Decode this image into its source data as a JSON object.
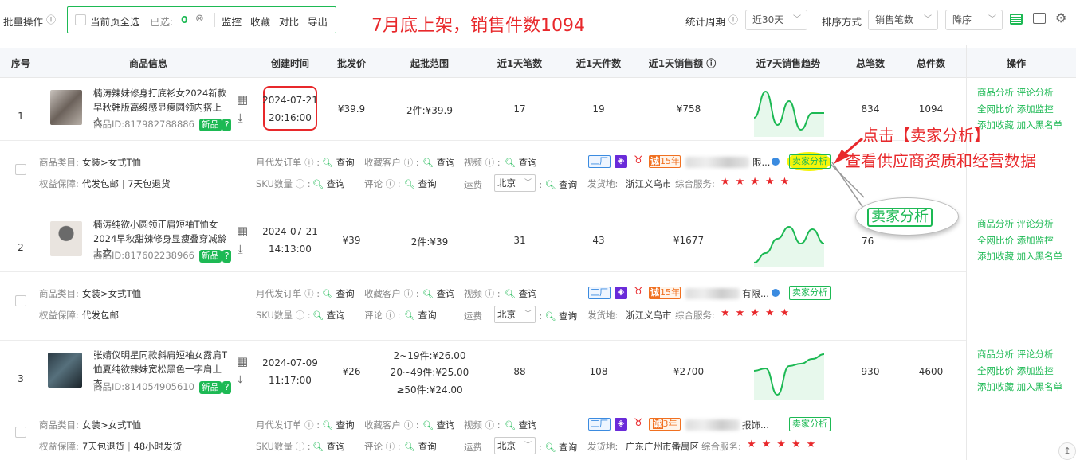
{
  "toolbar": {
    "batch_label": "批量操作",
    "select_all_label": "当前页全选",
    "selected_label": "已选:",
    "selected_count": "0",
    "actions": [
      "监控",
      "收藏",
      "对比",
      "导出"
    ],
    "period_label": "统计周期",
    "period_value": "近30天",
    "sort_label": "排序方式",
    "sort_value": "销售笔数",
    "order_value": "降序"
  },
  "annotations": {
    "top_note": "7月底上架，销售件数1094",
    "right_note_line1": "点击【卖家分析】",
    "right_note_line2": "查看供应商资质和经营数据",
    "zoom_label": "卖家分析"
  },
  "columns": [
    "序号",
    "商品信息",
    "创建时间",
    "批发价",
    "起批范围",
    "近1天笔数",
    "近1天件数",
    "近1天销售额",
    "近7天销售趋势",
    "总笔数",
    "总件数",
    "操作"
  ],
  "labels": {
    "product_id_prefix": "商品ID:",
    "new_badge": "新品",
    "category_label": "商品类目:",
    "guarantee_label": "权益保障:",
    "monthly_orders_label": "月代发订单",
    "sku_label": "SKU数量",
    "fav_customers_label": "收藏客户",
    "review_label": "评论",
    "video_label": "视频",
    "shipping_label": "运费",
    "query": "查询",
    "ship_from_label": "发货地:",
    "service_label": "综合服务:",
    "factory_tag": "工厂",
    "seller_analysis": "卖家分析"
  },
  "rows": [
    {
      "index": "1",
      "name": "楠涛辣妹修身打底衫女2024新款早秋韩版高级感显瘦圆领内搭上衣",
      "product_id": "817982788886",
      "created_date": "2024-07-21",
      "created_time": "20:16:00",
      "price": "¥39.9",
      "range_lines": [
        "2件:¥39.9"
      ],
      "day_orders": "17",
      "day_pieces": "19",
      "day_sales": "¥758",
      "total_orders": "834",
      "total_pieces": "1094",
      "trend": [
        0.35,
        0.9,
        0.2,
        0.7,
        0.1,
        0.45,
        0.45
      ],
      "category": "女装>女式T恤",
      "guarantees": [
        "代发包邮",
        "7天包退货"
      ],
      "ship_city": "北京",
      "ship_from": "浙江义乌市",
      "years": "15年",
      "seller_tail": "限...",
      "stars": "★★★★★",
      "ops": [
        "商品分析",
        "评论分析",
        "全网比价",
        "添加监控",
        "添加收藏",
        "加入黑名单"
      ]
    },
    {
      "index": "2",
      "name": "楠涛纯欲小圆领正肩短袖T恤女2024早秋甜辣修身显瘦叠穿减龄上衣",
      "product_id": "817602238966",
      "created_date": "2024-07-21",
      "created_time": "14:13:00",
      "price": "¥39",
      "range_lines": [
        "2件:¥39"
      ],
      "day_orders": "31",
      "day_pieces": "43",
      "day_sales": "¥1677",
      "total_orders": "",
      "total_pieces": "",
      "trend": [
        0.05,
        0.25,
        0.55,
        0.8,
        0.45,
        0.75,
        0.45
      ],
      "category": "女装>女式T恤",
      "guarantees": [
        "代发包邮"
      ],
      "ship_city": "北京",
      "ship_from": "浙江义乌市",
      "years": "15年",
      "seller_tail": "有限...",
      "stars": "★★★★★",
      "ops": [
        "商品分析",
        "评论分析",
        "全网比价",
        "添加监控",
        "添加收藏",
        "加入黑名单"
      ]
    },
    {
      "index": "3",
      "name": "张婧仪明星同款斜肩短袖女露肩T恤夏纯欲辣妹宽松黑色一字肩上衣",
      "product_id": "814054905610",
      "created_date": "2024-07-09",
      "created_time": "11:17:00",
      "price": "¥26",
      "range_lines": [
        "2~19件:¥26.00",
        "20~49件:¥25.00",
        "≥50件:¥24.00"
      ],
      "day_orders": "88",
      "day_pieces": "108",
      "day_sales": "¥2700",
      "total_orders": "930",
      "total_pieces": "4600",
      "trend": [
        0.55,
        0.6,
        0.05,
        0.65,
        0.7,
        0.8,
        0.9
      ],
      "category": "女装>女式T恤",
      "guarantees": [
        "7天包退货",
        "48小时发货"
      ],
      "ship_city": "北京",
      "ship_from": "广东广州市番禺区",
      "years": "3年",
      "seller_tail": "报饰...",
      "stars": "★★★★★",
      "ops": [
        "商品分析",
        "评论分析",
        "全网比价",
        "添加监控",
        "添加收藏",
        "加入黑名单"
      ]
    }
  ],
  "colors": {
    "accent": "#1db954",
    "annotation_red": "#e8282b",
    "highlight_yellow": "#f5f50a"
  }
}
